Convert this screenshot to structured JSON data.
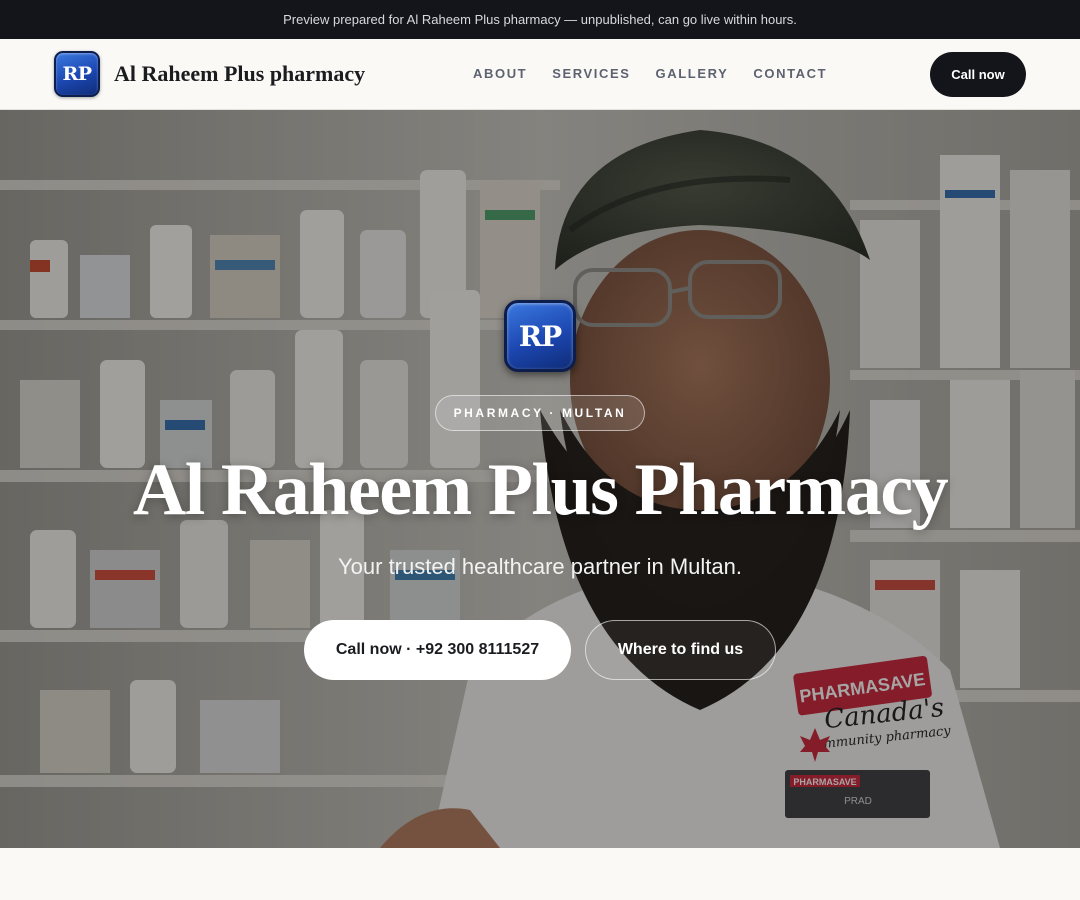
{
  "announcement": "Preview prepared for Al Raheem Plus pharmacy — unpublished, can go live within hours.",
  "header": {
    "logo_text": "RP",
    "brand_name": "Al Raheem Plus pharmacy",
    "nav": [
      {
        "label": "ABOUT"
      },
      {
        "label": "SERVICES"
      },
      {
        "label": "GALLERY"
      },
      {
        "label": "CONTACT"
      }
    ],
    "cta_label": "Call now"
  },
  "hero": {
    "logo_text": "RP",
    "eyebrow": "PHARMACY · MULTAN",
    "title": "Al Raheem Plus Pharmacy",
    "subtitle": "Your trusted healthcare partner in Multan.",
    "primary_cta": "Call now · +92 300 8111527",
    "secondary_cta": "Where to find us",
    "photo_coat_logo": "PHARMASAVE",
    "photo_coat_tagline": "Canada's",
    "photo_coat_tagline2": "community pharmacy",
    "photo_name_tag_brand": "PHARMASAVE",
    "photo_name_tag_name": "PRAD"
  },
  "colors": {
    "topbar_bg": "#13151b",
    "accent_blue": "#1c47b0",
    "dark_button": "#13151b",
    "page_bg": "#faf9f6"
  }
}
